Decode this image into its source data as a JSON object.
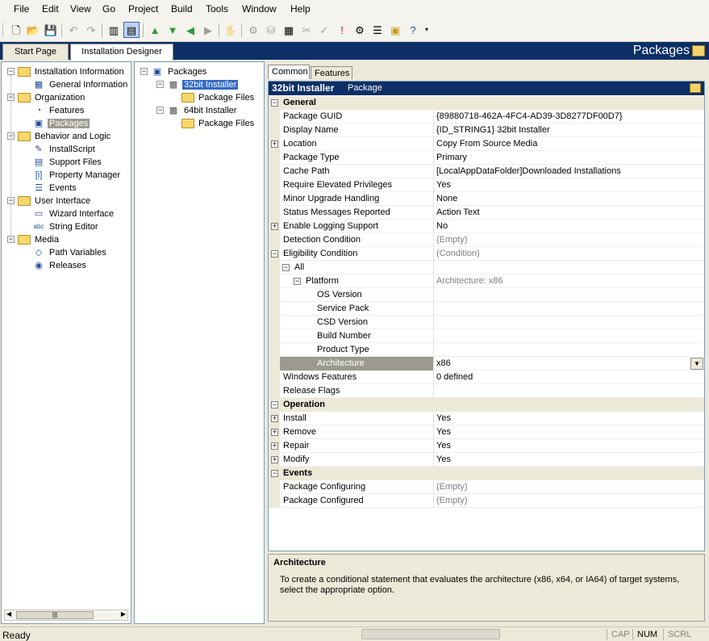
{
  "menubar": [
    "File",
    "Edit",
    "View",
    "Go",
    "Project",
    "Build",
    "Tools",
    "Window",
    "Help"
  ],
  "toolbar": {
    "buttons": [
      {
        "name": "new-icon",
        "glyph": "🗋",
        "enabled": true
      },
      {
        "name": "open-icon",
        "glyph": "📂",
        "enabled": true
      },
      {
        "name": "save-icon",
        "glyph": "💾",
        "enabled": true
      },
      {
        "name": "undo-icon",
        "glyph": "↶",
        "enabled": false
      },
      {
        "name": "redo-icon",
        "glyph": "↷",
        "enabled": false
      },
      {
        "name": "toggle-view-pane-icon",
        "glyph": "▥",
        "enabled": true
      },
      {
        "name": "toggle-view-pane-2-icon",
        "glyph": "▤",
        "enabled": true
      },
      {
        "name": "move-up-icon",
        "glyph": "▲",
        "enabled": true,
        "color": "#2e9b2e"
      },
      {
        "name": "move-down-icon",
        "glyph": "▼",
        "enabled": true,
        "color": "#2e9b2e"
      },
      {
        "name": "back-icon",
        "glyph": "◀",
        "enabled": true,
        "color": "#2e9b2e"
      },
      {
        "name": "forward-icon",
        "glyph": "▶",
        "enabled": false
      },
      {
        "name": "hand-icon",
        "glyph": "✋",
        "enabled": false
      },
      {
        "name": "build-icon",
        "glyph": "⚙",
        "enabled": false
      },
      {
        "name": "compile-icon",
        "glyph": "⛁",
        "enabled": false
      },
      {
        "name": "calendar-icon",
        "glyph": "▦",
        "enabled": true
      },
      {
        "name": "delete-icon",
        "glyph": "✂",
        "enabled": false
      },
      {
        "name": "validate-icon",
        "glyph": "✓",
        "enabled": false
      },
      {
        "name": "error-icon",
        "glyph": "!",
        "enabled": true,
        "color": "#d01010"
      },
      {
        "name": "settings-icon",
        "glyph": "⚙",
        "enabled": true
      },
      {
        "name": "list-icon",
        "glyph": "☰",
        "enabled": true
      },
      {
        "name": "package-icon",
        "glyph": "▣",
        "enabled": true,
        "color": "#c79b1a"
      },
      {
        "name": "help-icon",
        "glyph": "?",
        "enabled": true,
        "color": "#1d4e9c"
      }
    ]
  },
  "tabs": {
    "start_page": "Start Page",
    "installation_designer": "Installation Designer"
  },
  "header": {
    "title": "Packages"
  },
  "nav": [
    {
      "label": "Installation Information",
      "level": 0,
      "icon": "folder",
      "expander": "minus"
    },
    {
      "label": "General Information",
      "level": 1,
      "icon": "grid-icon"
    },
    {
      "label": "Organization",
      "level": 0,
      "icon": "folder",
      "expander": "minus"
    },
    {
      "label": "Features",
      "level": 1,
      "icon": "features-icon"
    },
    {
      "label": "Packages",
      "level": 1,
      "icon": "packages-icon",
      "selected": true
    },
    {
      "label": "Behavior and Logic",
      "level": 0,
      "icon": "folder",
      "expander": "minus"
    },
    {
      "label": "InstallScript",
      "level": 1,
      "icon": "script-icon"
    },
    {
      "label": "Support Files",
      "level": 1,
      "icon": "support-files-icon"
    },
    {
      "label": "Property Manager",
      "level": 1,
      "icon": "property-icon"
    },
    {
      "label": "Events",
      "level": 1,
      "icon": "events-icon"
    },
    {
      "label": "User Interface",
      "level": 0,
      "icon": "folder",
      "expander": "minus"
    },
    {
      "label": "Wizard Interface",
      "level": 1,
      "icon": "wizard-icon"
    },
    {
      "label": "String Editor",
      "level": 1,
      "icon": "string-editor-icon"
    },
    {
      "label": "Media",
      "level": 0,
      "icon": "folder",
      "expander": "minus"
    },
    {
      "label": "Path Variables",
      "level": 1,
      "icon": "path-icon"
    },
    {
      "label": "Releases",
      "level": 1,
      "icon": "releases-icon"
    }
  ],
  "nav_icon_glyphs": {
    "grid-icon": "▦",
    "features-icon": "◔",
    "packages-icon": "▣",
    "script-icon": "✎",
    "support-files-icon": "▤",
    "property-icon": "[i]",
    "events-icon": "☰",
    "wizard-icon": "▭",
    "string-editor-icon": "abc",
    "path-icon": "◇",
    "releases-icon": "◉"
  },
  "packages_tree": [
    {
      "label": "Packages",
      "level": 0,
      "icon": "packages-icon",
      "expander": "minus"
    },
    {
      "label": "32bit Installer",
      "level": 1,
      "icon": "installer-icon",
      "expander": "minus",
      "selected": true
    },
    {
      "label": "Package Files",
      "level": 2,
      "icon": "folder"
    },
    {
      "label": "64bit Installer",
      "level": 1,
      "icon": "installer-icon",
      "expander": "minus"
    },
    {
      "label": "Package Files",
      "level": 2,
      "icon": "folder"
    }
  ],
  "right_tabs": {
    "common": "Common",
    "features": "Features"
  },
  "grid": {
    "title": "32bit Installer",
    "type": "Package",
    "rows": [
      {
        "kind": "cat",
        "name": "General",
        "pm": "minus"
      },
      {
        "name": "Package GUID",
        "value": "{89880718-462A-4FC4-AD39-3D8277DF00D7}"
      },
      {
        "name": "Display Name",
        "value": "{ID_STRING1} 32bit Installer"
      },
      {
        "name": "Location",
        "value": "Copy From Source Media",
        "pm": "plus"
      },
      {
        "name": "Package Type",
        "value": "Primary"
      },
      {
        "name": "Cache Path",
        "value": "[LocalAppDataFolder]Downloaded Installations"
      },
      {
        "name": "Require Elevated Privileges",
        "value": "Yes"
      },
      {
        "name": "Minor Upgrade Handling",
        "value": "None"
      },
      {
        "name": "Status Messages Reported",
        "value": "Action Text"
      },
      {
        "name": "Enable Logging Support",
        "value": "No",
        "pm": "plus"
      },
      {
        "name": "Detection Condition",
        "value": "(Empty)",
        "dim": true
      },
      {
        "name": "Eligibility Condition",
        "value": "(Condition)",
        "dim": true,
        "pm": "minus"
      },
      {
        "name": "All",
        "value": "",
        "indent": 1,
        "pm": "minus"
      },
      {
        "name": "Platform",
        "value": "Architecture: x86",
        "dim": true,
        "indent": 2,
        "pm": "minus"
      },
      {
        "name": "OS Version",
        "value": "",
        "indent": 3
      },
      {
        "name": "Service Pack",
        "value": "",
        "indent": 3
      },
      {
        "name": "CSD Version",
        "value": "",
        "indent": 3
      },
      {
        "name": "Build Number",
        "value": "",
        "indent": 3
      },
      {
        "name": "Product Type",
        "value": "",
        "indent": 3
      },
      {
        "name": "Architecture",
        "value": "x86",
        "indent": 3,
        "selected": true,
        "dropdown": true
      },
      {
        "name": "Windows Features",
        "value": "0 defined"
      },
      {
        "name": "Release Flags",
        "value": ""
      },
      {
        "kind": "cat",
        "name": "Operation",
        "pm": "minus"
      },
      {
        "name": "Install",
        "value": "Yes",
        "pm": "plus"
      },
      {
        "name": "Remove",
        "value": "Yes",
        "pm": "plus"
      },
      {
        "name": "Repair",
        "value": "Yes",
        "pm": "plus"
      },
      {
        "name": "Modify",
        "value": "Yes",
        "pm": "plus"
      },
      {
        "kind": "cat",
        "name": "Events",
        "pm": "minus"
      },
      {
        "name": "Package Configuring",
        "value": "(Empty)",
        "dim": true
      },
      {
        "name": "Package Configured",
        "value": "(Empty)",
        "dim": true
      }
    ]
  },
  "description": {
    "title": "Architecture",
    "text": "To create a conditional statement that evaluates the architecture (x86, x64, or IA64) of target systems, select the appropriate option."
  },
  "status": {
    "text": "Ready",
    "cap": "CAP",
    "num": "NUM",
    "scrl": "SCRL"
  }
}
